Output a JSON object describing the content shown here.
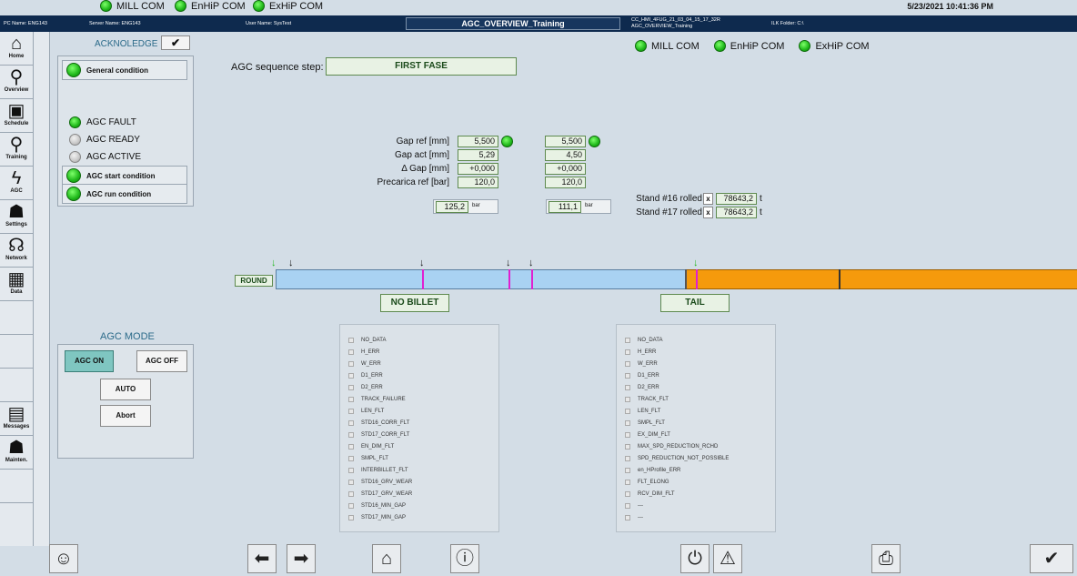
{
  "top_bar": {
    "coms": [
      {
        "label": "MILL COM",
        "status": "ok"
      },
      {
        "label": "EnHiP COM",
        "status": "ok"
      },
      {
        "label": "ExHiP COM",
        "status": "ok"
      }
    ],
    "datetime": "5/23/2021 10:41:36 PM"
  },
  "info_bar": {
    "pc_name": "PC Name:  ENG143",
    "server_name": "Server Name:  ENG143",
    "user_name": "User Name:  SysTest",
    "screen_title": "AGC_OVERVIEW_Training",
    "screen_id_line1": "CC_HMI_4FUG_21_03_04_15_17_32R",
    "screen_id_line2": "AGC_OVERVIEW_Training",
    "ilk_folder": "ILK Folder:  C:\\"
  },
  "nav": {
    "items": [
      {
        "label": "Home",
        "icon": "home-icon"
      },
      {
        "label": "Overview",
        "icon": "magnifier-icon"
      },
      {
        "label": "Schedule",
        "icon": "schedule-icon"
      },
      {
        "label": "Training",
        "icon": "magnifier-icon"
      },
      {
        "label": "AGC",
        "icon": "lightning-icon"
      },
      {
        "label": "Settings",
        "icon": "person-wrench-icon"
      },
      {
        "label": "Network",
        "icon": "network-icon"
      },
      {
        "label": "Data",
        "icon": "data-table-icon"
      },
      {
        "label": "Messages",
        "icon": "messages-icon"
      },
      {
        "label": "Mainten.",
        "icon": "maintenance-icon"
      }
    ]
  },
  "acknowledge": {
    "label": "ACKNOLEDGE"
  },
  "conditions": {
    "general": "General condition",
    "agc_fault": "AGC FAULT",
    "agc_ready": "AGC READY",
    "agc_active": "AGC ACTIVE",
    "agc_start": "AGC start condition",
    "agc_run": "AGC run condition"
  },
  "right_coms": [
    {
      "label": "MILL COM"
    },
    {
      "label": "EnHiP COM"
    },
    {
      "label": "ExHiP COM"
    }
  ],
  "sequence": {
    "label": "AGC sequence step:",
    "value": "FIRST FASE"
  },
  "gap_table": {
    "labels": [
      "Gap ref [mm]",
      "Gap act [mm]",
      "Δ Gap [mm]",
      "Precarica ref [bar]"
    ],
    "col1": [
      "5,500",
      "5,29",
      "+0,000",
      "120,0"
    ],
    "col2": [
      "5,500",
      "4,50",
      "+0,000",
      "120,0"
    ],
    "pressure1": "125,2",
    "pressure2": "111,1",
    "pressure_unit": "bar"
  },
  "stands": [
    {
      "label": "Stand #16 rolled",
      "mark": "x",
      "value": "78643,2",
      "unit": "t"
    },
    {
      "label": "Stand #17 rolled",
      "mark": "x",
      "value": "78643,2",
      "unit": "t"
    }
  ],
  "track": {
    "round_label": "ROUND",
    "left_tag": "NO BILLET",
    "right_tag": "TAIL"
  },
  "agc_mode": {
    "title": "AGC MODE",
    "on": "AGC ON",
    "off": "AGC OFF",
    "auto": "AUTO",
    "abort": "Abort"
  },
  "errors_left": [
    "NO_DATA",
    "H_ERR",
    "W_ERR",
    "D1_ERR",
    "D2_ERR",
    "TRACK_FAILURE",
    "LEN_FLT",
    "STD16_CORR_FLT",
    "STD17_CORR_FLT",
    "EN_DIM_FLT",
    "SMPL_FLT",
    "INTERBILLET_FLT",
    "STD16_GRV_WEAR",
    "STD17_GRV_WEAR",
    "STD16_MIN_GAP",
    "STD17_MIN_GAP"
  ],
  "errors_right": [
    "NO_DATA",
    "H_ERR",
    "W_ERR",
    "D1_ERR",
    "D2_ERR",
    "TRACK_FLT",
    "LEN_FLT",
    "SMPL_FLT",
    "EX_DIM_FLT",
    "MAX_SPD_REDUCTION_RCHD",
    "SPD_REDUCTION_NOT_POSSIBLE",
    "en_HProfile_ERR",
    "FLT_ELONG",
    "RCV_DIM_FLT",
    "---",
    "---"
  ],
  "colors": {
    "bar_blue": "#a9d2f2",
    "bar_orange": "#f59a0c",
    "led_green": "#1fb81a",
    "header_dark": "#0e2a4e"
  }
}
